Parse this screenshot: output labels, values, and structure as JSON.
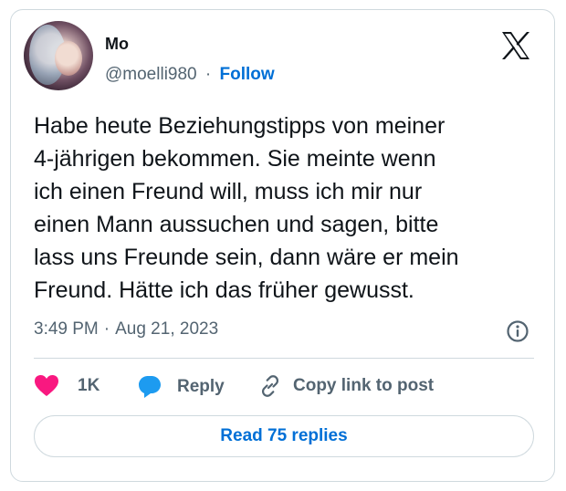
{
  "author": {
    "name": "Mo",
    "handle": "@moelli980",
    "separator": "·",
    "follow_label": "Follow"
  },
  "tweet": {
    "lines": [
      "Habe heute Beziehungstipps von meiner",
      "4-jährigen bekommen. Sie meinte wenn",
      "ich einen Freund will, muss ich mir nur",
      "einen Mann aussuchen und sagen, bitte",
      "lass uns Freunde sein, dann wäre er mein",
      "Freund. Hätte ich das früher gewusst."
    ],
    "time": "3:49 PM",
    "separator": "·",
    "date": "Aug 21, 2023"
  },
  "actions": {
    "like_count": "1K",
    "reply_label": "Reply",
    "copy_label": "Copy link to post"
  },
  "read_replies_label": "Read 75 replies",
  "colors": {
    "like_heart": "#f91880",
    "reply_bubble": "#1d9bf0",
    "link_blue": "#006fd6",
    "muted_text": "#536471",
    "border": "#cfd9de"
  },
  "icons": [
    "x-logo-icon",
    "info-icon",
    "heart-icon",
    "reply-bubble-icon",
    "link-icon"
  ]
}
